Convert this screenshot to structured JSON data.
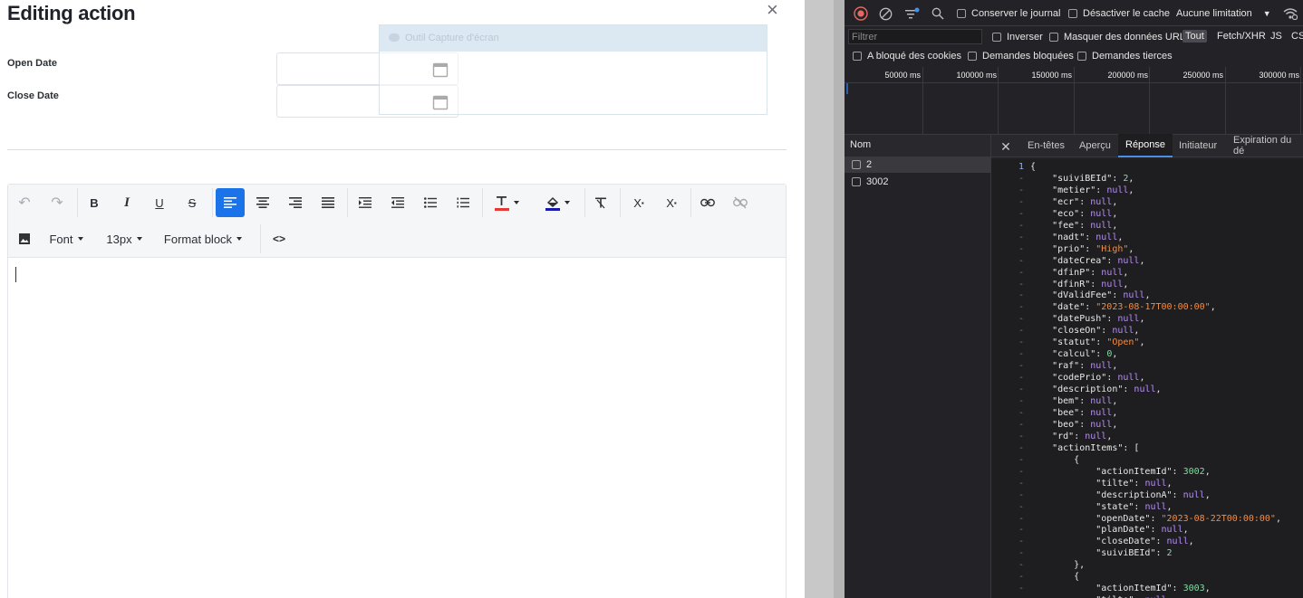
{
  "modal": {
    "title": "Editing action",
    "close_glyph": "×",
    "open_date_label": "Open Date",
    "close_date_label": "Close Date",
    "capture_tool_label": "Outil Capture d'écran"
  },
  "editor": {
    "font_label": "Font",
    "size_label": "13px",
    "format_label": "Format block",
    "icons": {
      "undo": "↶",
      "redo": "↷",
      "bold": "B",
      "italic": "I",
      "underline": "U",
      "strike": "S",
      "subscript": "X",
      "superscript": "X",
      "code": "<>"
    },
    "text_color": "#e53935",
    "bg_color": "#1a1aaa",
    "accent": "#1a73e8"
  },
  "devtools": {
    "checkbox_preserve": "Conserver le journal",
    "checkbox_cache": "Désactiver le cache",
    "throttle": "Aucune limitation",
    "filter_placeholder": "Filtrer",
    "invert": "Inverser",
    "hide_urls": "Masquer des données URL",
    "type_all": "Tout",
    "type_fetch": "Fetch/XHR",
    "type_js": "JS",
    "type_css": "CSS",
    "blocked_cookies": "A bloqué des cookies",
    "blocked_requests": "Demandes bloquées",
    "third_party": "Demandes tierces",
    "timeline": [
      "50000 ms",
      "100000 ms",
      "150000 ms",
      "200000 ms",
      "250000 ms",
      "300000 ms"
    ],
    "names_header": "Nom",
    "requests": [
      "2",
      "3002"
    ],
    "tabs": [
      "En-têtes",
      "Aperçu",
      "Réponse",
      "Initiateur",
      "Expiration du dé"
    ],
    "active_tab": "Réponse",
    "line_number": "1",
    "gutter_mark": "-",
    "code_lines": [
      "{",
      "    \"suiviBEId\": 2,",
      "    \"metier\": null,",
      "    \"ecr\": null,",
      "    \"eco\": null,",
      "    \"fee\": null,",
      "    \"nadt\": null,",
      "    \"prio\": \"High\",",
      "    \"dateCrea\": null,",
      "    \"dfinP\": null,",
      "    \"dfinR\": null,",
      "    \"dValidFee\": null,",
      "    \"date\": \"2023-08-17T00:00:00\",",
      "    \"datePush\": null,",
      "    \"closeOn\": null,",
      "    \"statut\": \"Open\",",
      "    \"calcul\": 0,",
      "    \"raf\": null,",
      "    \"codePrio\": null,",
      "    \"description\": null,",
      "    \"bem\": null,",
      "    \"bee\": null,",
      "    \"beo\": null,",
      "    \"rd\": null,",
      "    \"actionItems\": [",
      "        {",
      "            \"actionItemId\": 3002,",
      "            \"tilte\": null,",
      "            \"descriptionA\": null,",
      "            \"state\": null,",
      "            \"openDate\": \"2023-08-22T00:00:00\",",
      "            \"planDate\": null,",
      "            \"closeDate\": null,",
      "            \"suiviBEId\": 2",
      "        },",
      "        {",
      "            \"actionItemId\": 3003,",
      "            \"tilte\": null,"
    ]
  }
}
